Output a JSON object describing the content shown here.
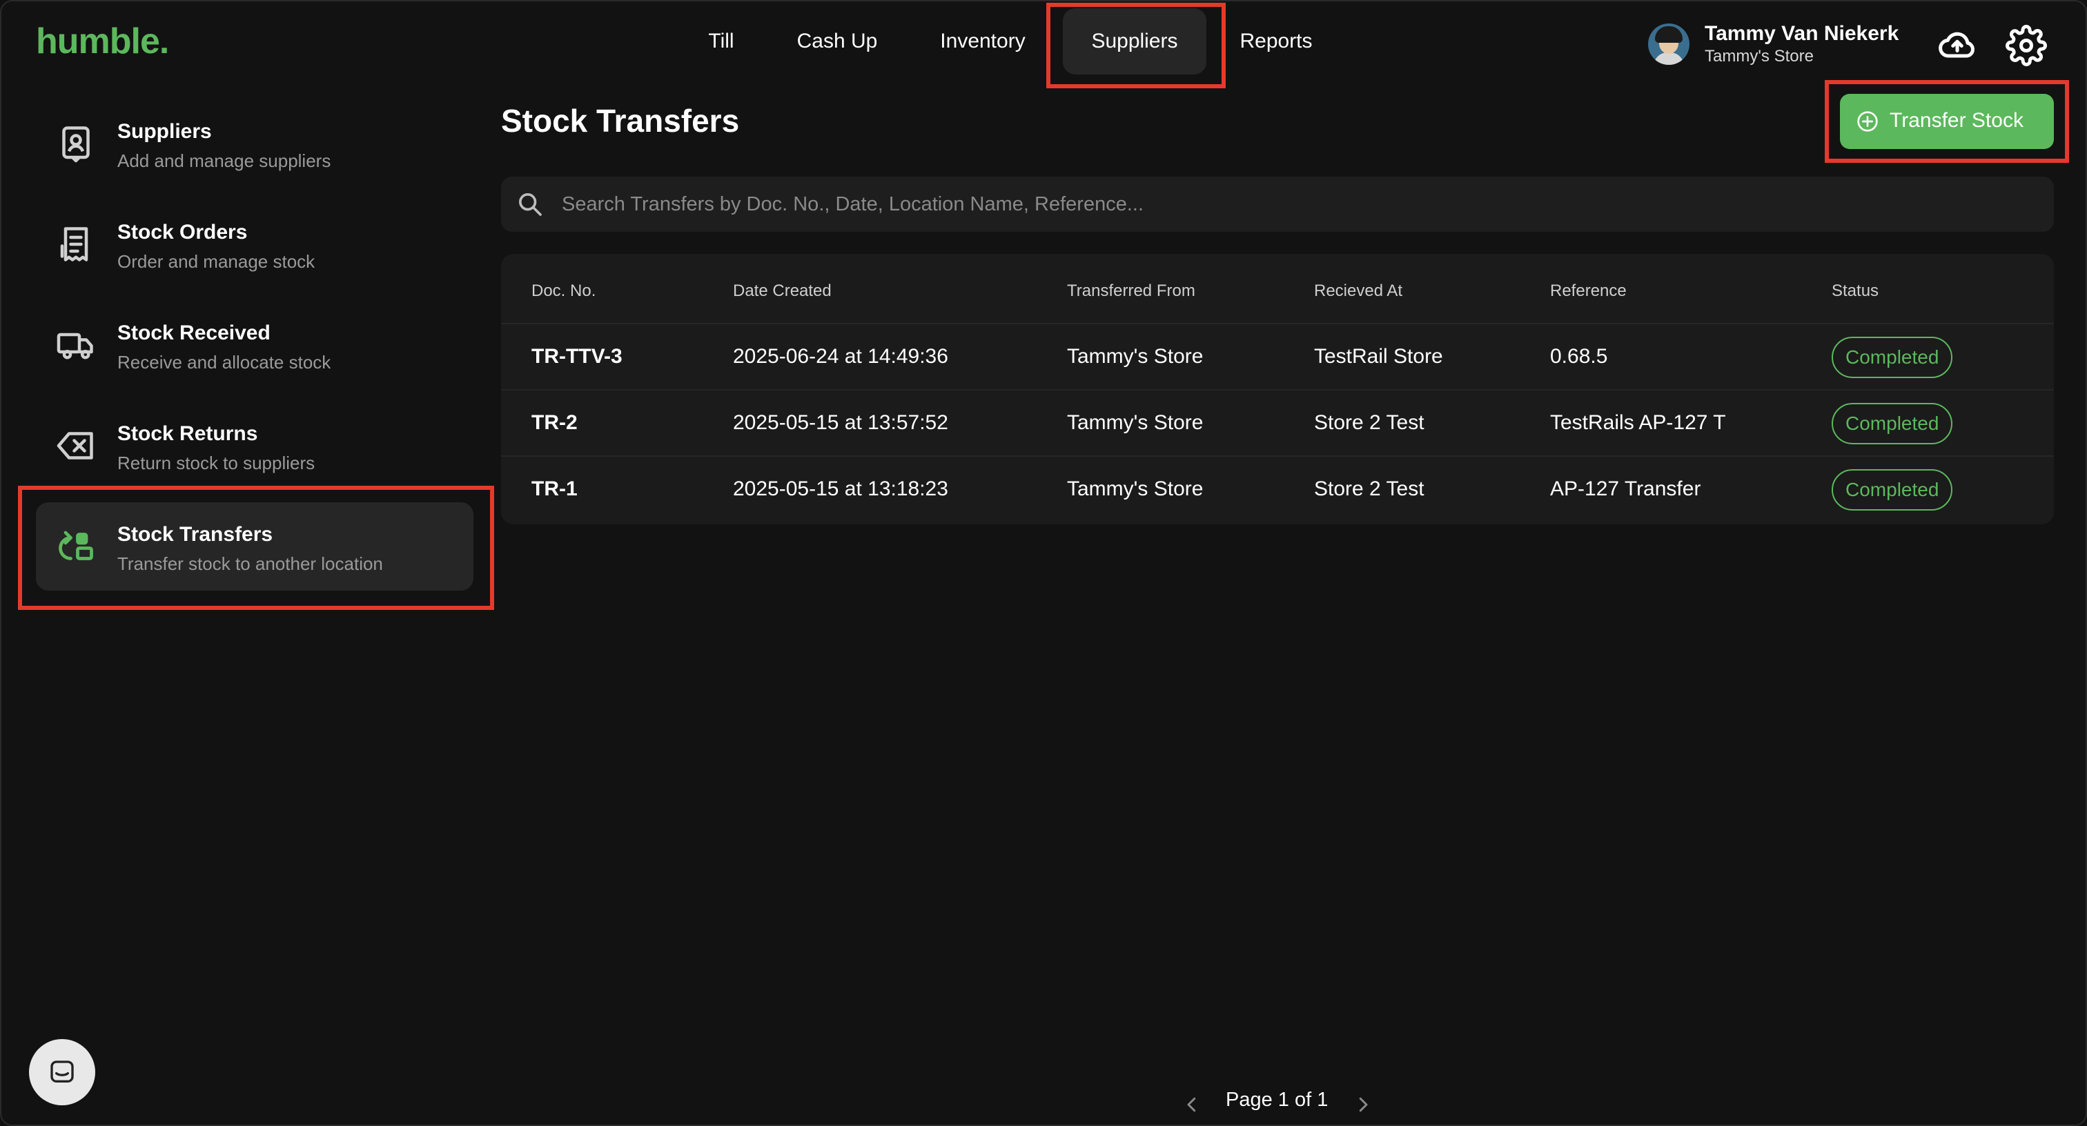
{
  "brand": {
    "logo": "humble."
  },
  "nav": {
    "items": [
      {
        "label": "Till"
      },
      {
        "label": "Cash Up"
      },
      {
        "label": "Inventory"
      },
      {
        "label": "Suppliers"
      },
      {
        "label": "Reports"
      }
    ],
    "active": "Suppliers"
  },
  "user": {
    "name": "Tammy Van Niekerk",
    "store": "Tammy's Store"
  },
  "header_icons": [
    "cloud-upload-icon",
    "gear-icon"
  ],
  "sidebar": {
    "items": [
      {
        "title": "Suppliers",
        "subtitle": "Add and manage suppliers",
        "icon": "supplier-badge-icon"
      },
      {
        "title": "Stock Orders",
        "subtitle": "Order and manage stock",
        "icon": "order-receipt-icon"
      },
      {
        "title": "Stock Received",
        "subtitle": "Receive and allocate stock",
        "icon": "truck-icon"
      },
      {
        "title": "Stock Returns",
        "subtitle": "Return stock to suppliers",
        "icon": "return-x-icon"
      },
      {
        "title": "Stock Transfers",
        "subtitle": "Transfer stock to another location",
        "icon": "transfer-icon"
      }
    ],
    "active": "Stock Transfers"
  },
  "main": {
    "title": "Stock Transfers",
    "transfer_button": "Transfer Stock",
    "search_placeholder": "Search Transfers by Doc. No., Date, Location Name, Reference..."
  },
  "table": {
    "columns": [
      "Doc. No.",
      "Date Created",
      "Transferred From",
      "Recieved At",
      "Reference",
      "Status"
    ],
    "rows": [
      {
        "doc": "TR-TTV-3",
        "date": "2025-06-24 at 14:49:36",
        "from": "Tammy's Store",
        "to": "TestRail Store",
        "reference": "0.68.5",
        "status": "Completed"
      },
      {
        "doc": "TR-2",
        "date": "2025-05-15 at 13:57:52",
        "from": "Tammy's Store",
        "to": "Store 2 Test",
        "reference": "TestRails AP-127 T",
        "status": "Completed"
      },
      {
        "doc": "TR-1",
        "date": "2025-05-15 at 13:18:23",
        "from": "Tammy's Store",
        "to": "Store 2 Test",
        "reference": "AP-127 Transfer",
        "status": "Completed"
      }
    ]
  },
  "pagination": {
    "label": "Page 1 of 1"
  },
  "colors": {
    "accent": "#5cb85c",
    "highlight": "#e53a2b",
    "background": "#121212"
  }
}
